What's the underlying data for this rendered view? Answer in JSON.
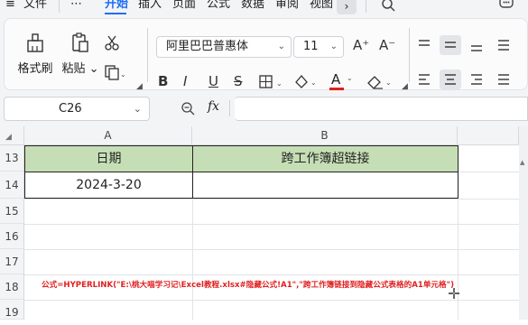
{
  "menu": {
    "file": "文件",
    "more": "⋯",
    "tabs": [
      "开始",
      "插入",
      "页面",
      "公式",
      "数据",
      "审阅",
      "视图"
    ],
    "active_tab": "开始",
    "overflow_arrow": "›"
  },
  "ribbon": {
    "format_painter": "格式刷",
    "paste": "粘贴",
    "font_name": "阿里巴巴普惠体",
    "font_size": "11",
    "bold": "B",
    "italic": "I",
    "underline": "U",
    "strike": "S",
    "font_color_letter": "A",
    "font_color": "#e0201a",
    "grow_font": "A⁺",
    "shrink_font": "A⁻"
  },
  "formula_bar": {
    "name_box": "C26",
    "fx_label": "fx",
    "formula": ""
  },
  "sheet": {
    "columns": [
      "A",
      "B"
    ],
    "rows": [
      "13",
      "14",
      "15",
      "16",
      "17",
      "18",
      "19"
    ],
    "header_fill": "#c6deb5",
    "cells": {
      "A13": "日期",
      "B13": "跨工作簿超链接",
      "A14": "2024-3-20",
      "B14": ""
    },
    "note": "公式=HYPERLINK(\"E:\\桃大喵学习记\\Excel教程.xlsx#隐藏公式!A1\",\"跨工作簿链接到隐藏公式表格的A1单元格\")",
    "note_color": "#e02020"
  }
}
